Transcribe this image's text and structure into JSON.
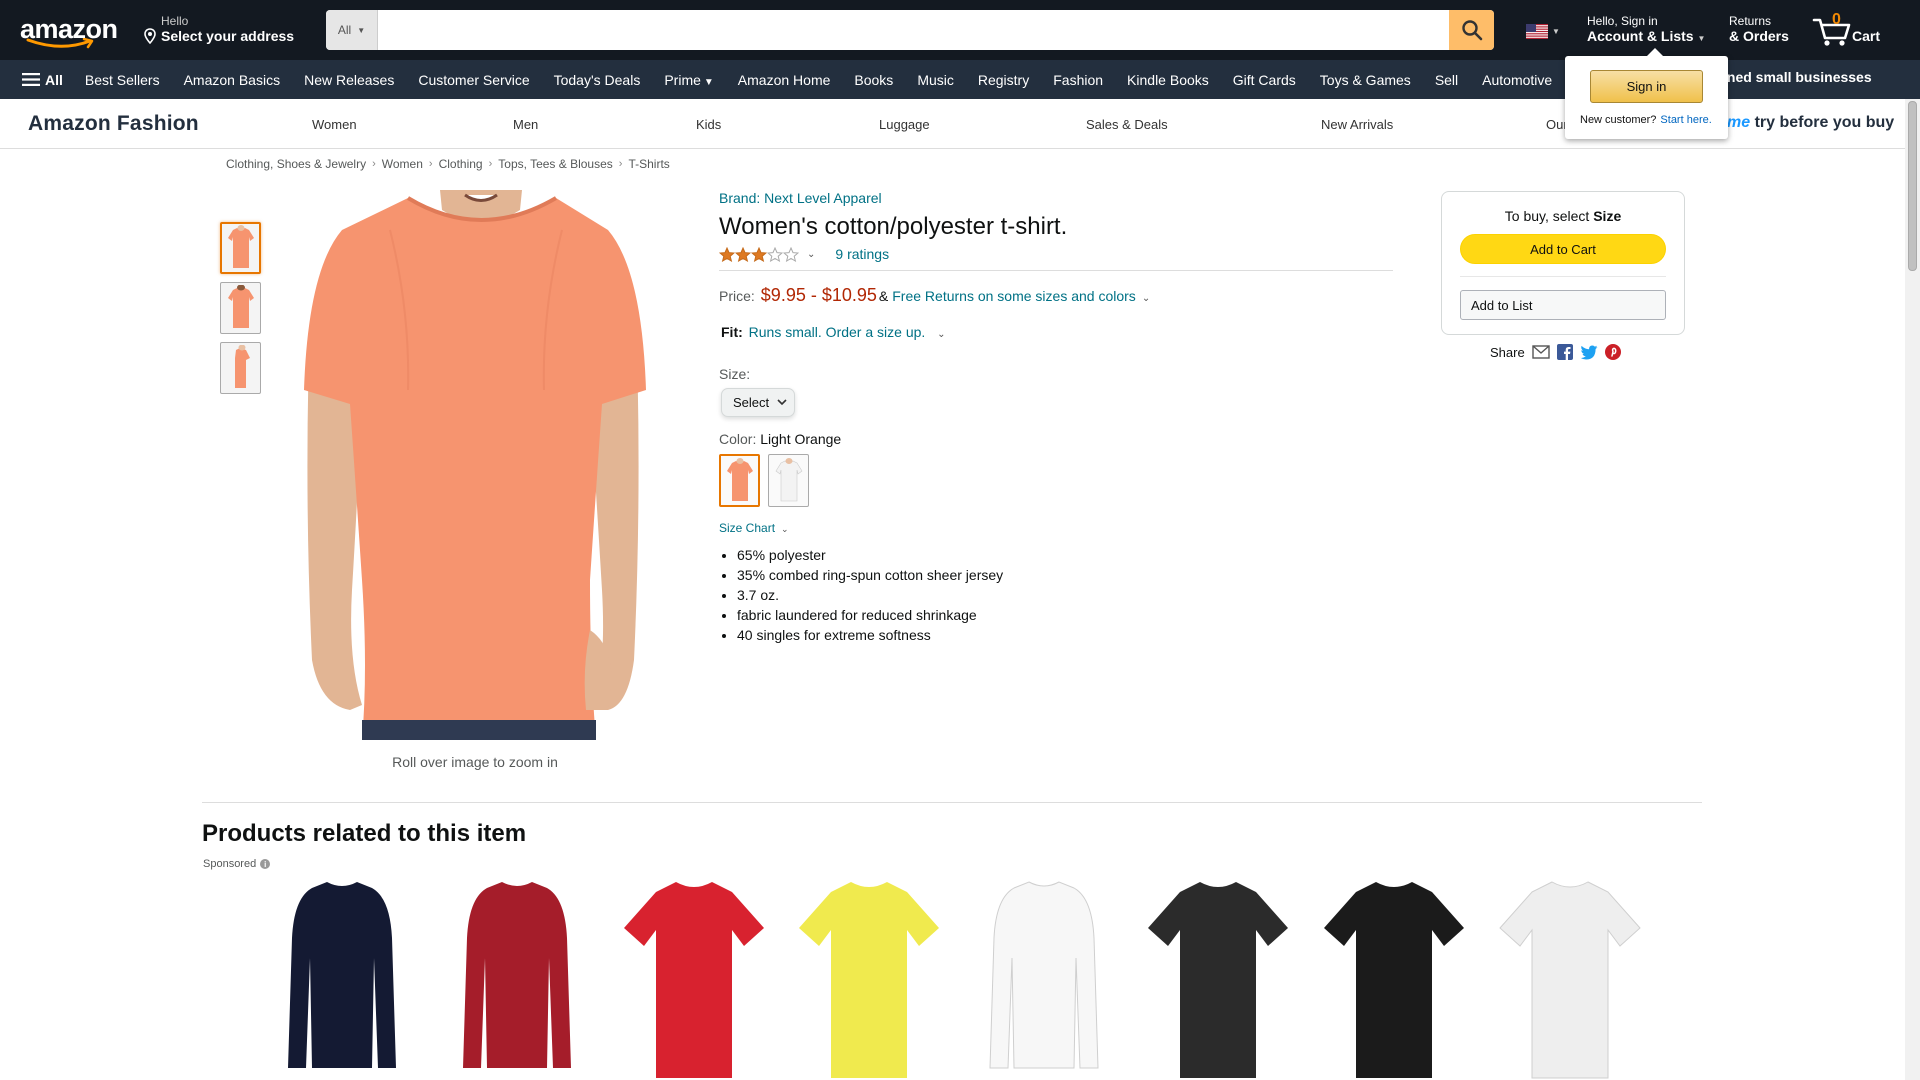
{
  "header": {
    "logo_text": "amazon",
    "deliver_line1": "Hello",
    "deliver_line2": "Select your address",
    "search_category": "All",
    "search_placeholder": "",
    "account_line1": "Hello, Sign in",
    "account_line2": "Account & Lists",
    "returns_line1": "Returns",
    "returns_line2": "& Orders",
    "cart_count": "0",
    "cart_label": "Cart"
  },
  "nav": {
    "all_label": "All",
    "items": [
      "Best Sellers",
      "Amazon Basics",
      "New Releases",
      "Customer Service",
      "Today's Deals",
      "Prime",
      "Amazon Home",
      "Books",
      "Music",
      "Registry",
      "Fashion",
      "Kindle Books",
      "Gift Cards",
      "Toys & Games",
      "Sell",
      "Automotive"
    ],
    "promo": "wned small businesses"
  },
  "signin_flyout": {
    "button": "Sign in",
    "new_customer": "New customer?",
    "start_here": "Start here."
  },
  "subnav": {
    "brand": "Amazon Fashion",
    "links": [
      "Women",
      "Men",
      "Kids",
      "Luggage",
      "Sales & Deals",
      "New Arrivals",
      "Our"
    ],
    "prime_prefix": "me",
    "prime_suffix": " try before you buy"
  },
  "breadcrumb": [
    "Clothing, Shoes & Jewelry",
    "Women",
    "Clothing",
    "Tops, Tees & Blouses",
    "T-Shirts"
  ],
  "product": {
    "brand_link": "Brand: Next Level Apparel",
    "title": "Women's cotton/polyester t-shirt.",
    "rating_stars": 3,
    "ratings_text": "9 ratings",
    "price_label": "Price:",
    "price": "$9.95 - $10.95",
    "ampersand": "&",
    "free_returns": "Free Returns on some sizes and colors",
    "fit_label": "Fit:",
    "fit_value": "Runs small. Order a size up.",
    "size_label": "Size:",
    "size_select": "Select",
    "color_label": "Color:",
    "color_value": "Light Orange",
    "size_chart": "Size Chart",
    "bullets": [
      "65% polyester",
      "35% combed ring-spun cotton sheer jersey",
      "3.7 oz.",
      "fabric laundered for reduced shrinkage",
      "40 singles for extreme softness"
    ],
    "zoom_hint": "Roll over image to zoom in",
    "shirt_color": "#f6946f"
  },
  "buybox": {
    "tobuy_prefix": "To buy, select ",
    "tobuy_strong": "Size",
    "add_to_cart": "Add to Cart",
    "add_to_list": "Add to List",
    "share": "Share"
  },
  "related": {
    "title": "Products related to this item",
    "sponsored": "Sponsored",
    "items": [
      {
        "name": "navy-zip-collar-top",
        "color": "#141a33"
      },
      {
        "name": "red-long-sleeve-tee",
        "color": "#a51d2a"
      },
      {
        "name": "red-vneck-tee",
        "color": "#d8222f"
      },
      {
        "name": "yellow-tee",
        "color": "#f0ea4e"
      },
      {
        "name": "white-long-sleeve-tee",
        "color": "#f7f7f7"
      },
      {
        "name": "black-vneck-tee",
        "color": "#2b2b2b"
      },
      {
        "name": "black-graphic-tee",
        "color": "#1b1b1b"
      },
      {
        "name": "white-graphic-tee",
        "color": "#eeeeee"
      }
    ]
  },
  "colors": {
    "header_bg": "#131921",
    "nav_bg": "#232f3e",
    "search_button": "#febd69",
    "link": "#007185",
    "price": "#b12704",
    "cart_button": "#ffd814",
    "selected_border": "#e77600"
  }
}
